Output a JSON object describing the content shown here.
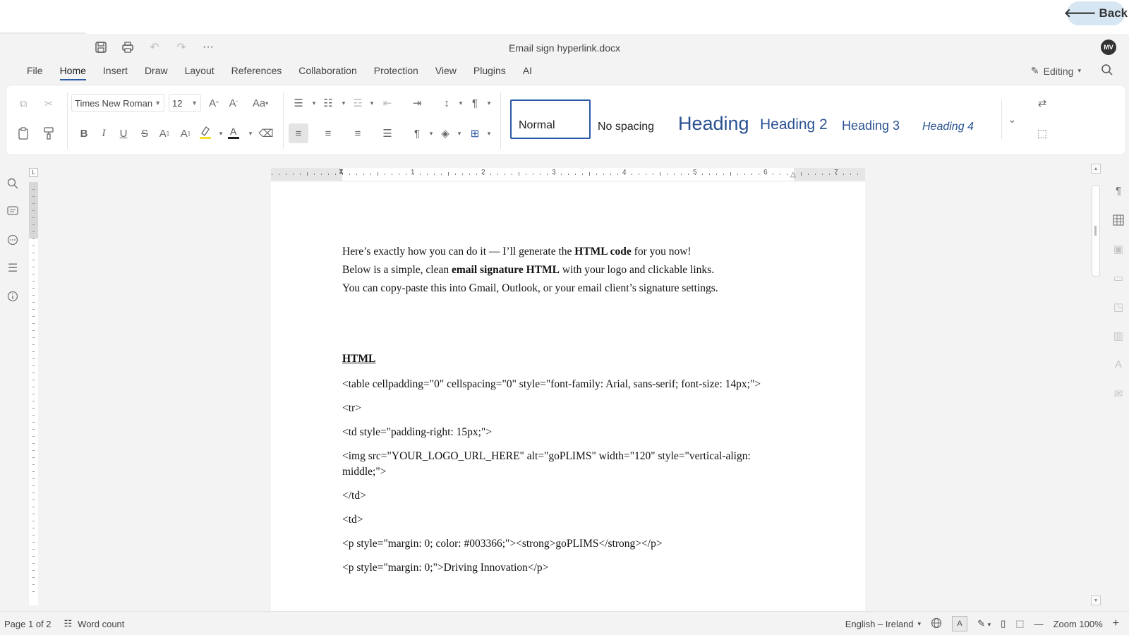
{
  "top": {
    "back_label": "Back"
  },
  "titlebar": {
    "doc_title": "Email sign hyperlink.docx",
    "avatar_initials": "MV",
    "more_label": "···"
  },
  "menu": {
    "items": [
      "File",
      "Home",
      "Insert",
      "Draw",
      "Layout",
      "References",
      "Collaboration",
      "Protection",
      "View",
      "Plugins",
      "AI"
    ],
    "active": "Home",
    "mode_label": "Editing"
  },
  "ribbon": {
    "font_family": "Times New Roman",
    "font_size": "12",
    "styles": [
      "Normal",
      "No spacing",
      "Heading",
      "Heading 2",
      "Heading 3",
      "Heading 4"
    ],
    "highlight_color": "#f5e12a",
    "font_color": "#222222",
    "accent_color": "#2a5aa5"
  },
  "ruler": {
    "numbers": [
      "1",
      "2",
      "3",
      "4",
      "5",
      "6",
      "7"
    ]
  },
  "document": {
    "intro1_a": "Here’s exactly how you can do it — I’ll generate the ",
    "intro1_b": "HTML code",
    "intro1_c": " for you now!",
    "intro2_a": "Below is a simple, clean ",
    "intro2_b": "email signature HTML",
    "intro2_c": " with your logo and clickable links.",
    "intro3": "You can copy-paste this into Gmail, Outlook, or your email client’s signature settings.",
    "heading": "HTML",
    "code_lines": [
      "<table cellpadding=\"0\" cellspacing=\"0\" style=\"font-family: Arial, sans-serif; font-size: 14px;\">",
      "<tr>",
      "<td style=\"padding-right: 15px;\">",
      "<img src=\"YOUR_LOGO_URL_HERE\" alt=\"goPLIMS\" width=\"120\" style=\"vertical-align: middle;\">",
      "</td>",
      "<td>",
      "<p style=\"margin: 0; color: #003366;\"><strong>goPLIMS</strong></p>",
      "<p style=\"margin: 0;\">Driving Innovation</p>"
    ]
  },
  "status": {
    "page": "Page 1 of 2",
    "word_count": "Word count",
    "language": "English – Ireland",
    "zoom": "Zoom 100%"
  }
}
